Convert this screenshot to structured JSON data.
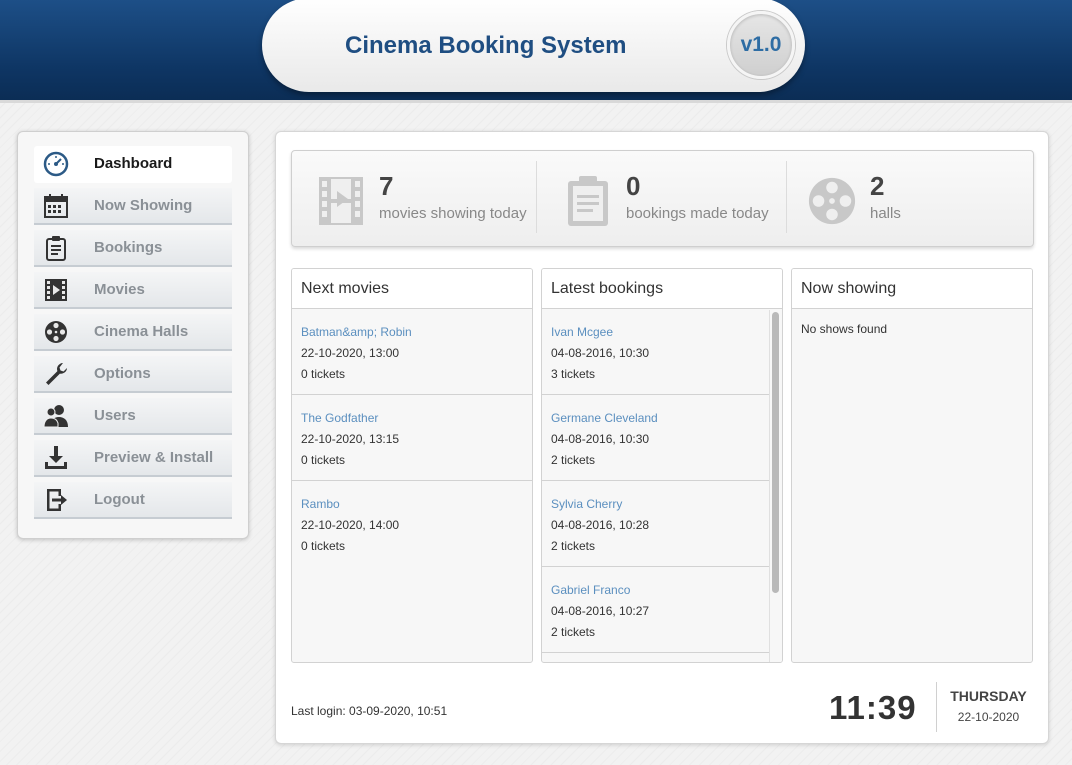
{
  "header": {
    "title": "Cinema Booking System",
    "version": "v1.0"
  },
  "sidebar": {
    "items": [
      {
        "label": "Dashboard",
        "icon": "dashboard-gauge-icon",
        "active": true
      },
      {
        "label": "Now Showing",
        "icon": "calendar-icon",
        "active": false
      },
      {
        "label": "Bookings",
        "icon": "clipboard-icon",
        "active": false
      },
      {
        "label": "Movies",
        "icon": "film-icon",
        "active": false
      },
      {
        "label": "Cinema Halls",
        "icon": "film-reel-icon",
        "active": false
      },
      {
        "label": "Options",
        "icon": "wrench-icon",
        "active": false
      },
      {
        "label": "Users",
        "icon": "users-icon",
        "active": false
      },
      {
        "label": "Preview & Install",
        "icon": "download-icon",
        "active": false
      },
      {
        "label": "Logout",
        "icon": "logout-icon",
        "active": false
      }
    ]
  },
  "stats": [
    {
      "value": "7",
      "label": "movies showing today",
      "icon": "film-icon"
    },
    {
      "value": "0",
      "label": "bookings made today",
      "icon": "clipboard-icon"
    },
    {
      "value": "2",
      "label": "halls",
      "icon": "film-reel-icon"
    }
  ],
  "next_movies": {
    "title": "Next movies",
    "items": [
      {
        "name": "Batman&amp; Robin",
        "datetime": "22-10-2020, 13:00",
        "tickets": "0 tickets"
      },
      {
        "name": "The Godfather",
        "datetime": "22-10-2020, 13:15",
        "tickets": "0 tickets"
      },
      {
        "name": "Rambo",
        "datetime": "22-10-2020, 14:00",
        "tickets": "0 tickets"
      }
    ]
  },
  "latest_bookings": {
    "title": "Latest bookings",
    "items": [
      {
        "name": "Ivan Mcgee",
        "datetime": "04-08-2016, 10:30",
        "tickets": "3 tickets"
      },
      {
        "name": "Germane Cleveland",
        "datetime": "04-08-2016, 10:30",
        "tickets": "2 tickets"
      },
      {
        "name": "Sylvia Cherry",
        "datetime": "04-08-2016, 10:28",
        "tickets": "2 tickets"
      },
      {
        "name": "Gabriel Franco",
        "datetime": "04-08-2016, 10:27",
        "tickets": "2 tickets"
      }
    ]
  },
  "now_showing": {
    "title": "Now showing",
    "empty_text": "No shows found"
  },
  "footer": {
    "last_login": "Last login: 03-09-2020, 10:51",
    "time": "11:39",
    "day": "THURSDAY",
    "date": "22-10-2020"
  },
  "colors": {
    "header_blue": "#0e3563",
    "title_blue": "#1f4e82",
    "link_blue": "#5b8fbf"
  }
}
